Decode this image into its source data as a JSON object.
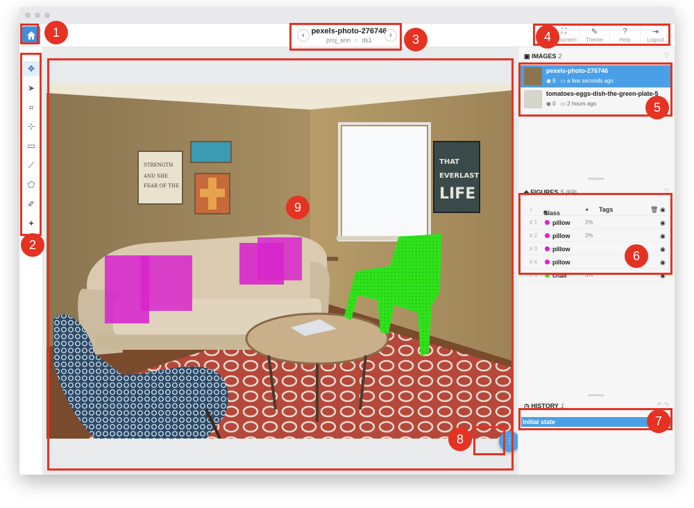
{
  "header": {
    "image_title": "pexels-photo-276746",
    "project": "proj_ann",
    "separator": ">",
    "dataset": "ds1",
    "prev_icon": "chevron-left-icon",
    "next_icon": "chevron-right-icon"
  },
  "top_actions": [
    {
      "label": "Fullscreen",
      "icon": "fullscreen-icon"
    },
    {
      "label": "Theme",
      "icon": "theme-icon"
    },
    {
      "label": "Help",
      "icon": "help-icon"
    },
    {
      "label": "Logout",
      "icon": "logout-icon"
    }
  ],
  "tools": [
    "move-icon",
    "select-icon",
    "crop-icon",
    "point-icon",
    "rectangle-icon",
    "polyline-icon",
    "polygon-icon",
    "brush-icon",
    "magic-wand-icon"
  ],
  "images_panel": {
    "title": "IMAGES",
    "count": "2",
    "items": [
      {
        "name": "pexels-photo-276746",
        "figures": "8",
        "time": "a few seconds ago"
      },
      {
        "name": "tomatoes-eggs-dish-the-green-plate-5",
        "figures": "0",
        "time": "2 hours ago"
      }
    ]
  },
  "figures_panel": {
    "title": "FIGURES",
    "count": "5 (69)",
    "col_class": "Class",
    "col_tags": "Tags",
    "rows": [
      {
        "num": "# 1",
        "name": "pillow",
        "pct": "2%",
        "color": "#e21bd3"
      },
      {
        "num": "# 2",
        "name": "pillow",
        "pct": "2%",
        "color": "#e21bd3"
      },
      {
        "num": "# 3",
        "name": "pillow",
        "pct": "",
        "color": "#e21bd3"
      },
      {
        "num": "# 4",
        "name": "pillow",
        "pct": "",
        "color": "#e21bd3"
      },
      {
        "num": "# 5",
        "name": "chair",
        "pct": "3%",
        "color": "#31e21b"
      }
    ]
  },
  "history_panel": {
    "title": "HISTORY",
    "count": "1",
    "items": [
      "Initial state"
    ]
  },
  "callouts": [
    "1",
    "2",
    "3",
    "4",
    "5",
    "6",
    "7",
    "8",
    "9"
  ],
  "colors": {
    "accent": "#4aa0e6",
    "callout": "#e53223",
    "pillow": "#e21bd3",
    "chair": "#31e21b"
  }
}
